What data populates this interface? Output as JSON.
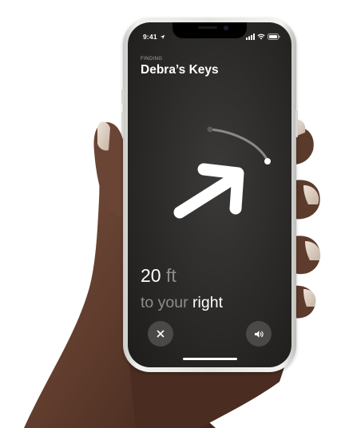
{
  "status_bar": {
    "time": "9:41",
    "icons": [
      "location-arrow-icon",
      "signal-icon",
      "wifi-icon",
      "battery-icon"
    ]
  },
  "header": {
    "finding_label": "FINDING",
    "item_name": "Debra’s Keys"
  },
  "guidance": {
    "distance_value": "20",
    "distance_unit": "ft",
    "direction_prefix": "to your",
    "direction_word": "right",
    "arrow_icon": "direction-arrow-icon"
  },
  "controls": {
    "close_icon": "close-icon",
    "sound_icon": "speaker-icon"
  },
  "colors": {
    "screen_background": "#2c2b29",
    "primary_text": "#ffffff",
    "secondary_text": "#8e8d8b",
    "button_background": "#4a4947"
  }
}
